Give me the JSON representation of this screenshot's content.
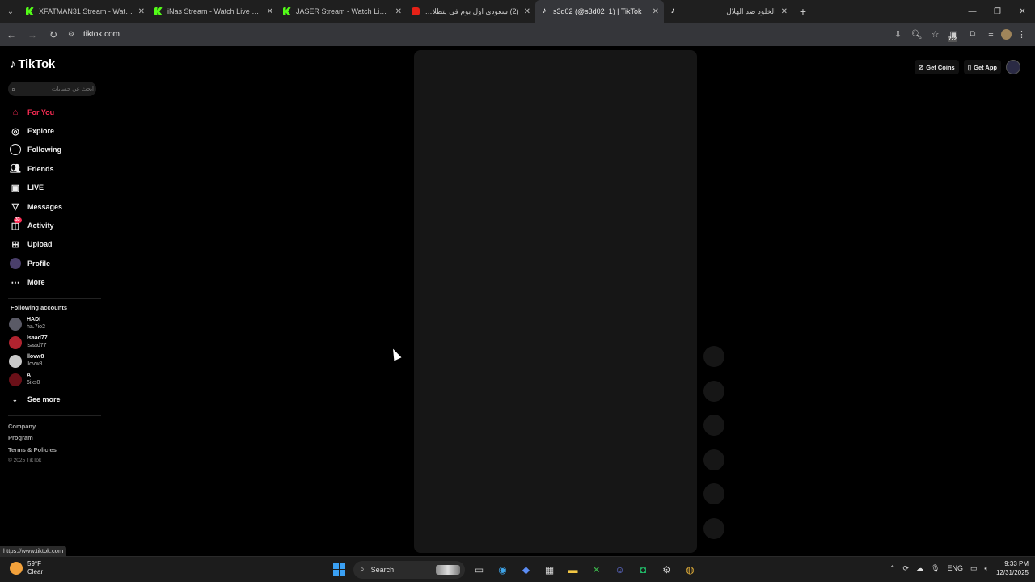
{
  "browser": {
    "tabs": [
      {
        "title": "XFATMAN31 Stream - Watch Live on Kick",
        "favicon": "kick-icon",
        "active": false
      },
      {
        "title": "iNas Stream - Watch Live on Kick",
        "favicon": "kick-icon",
        "active": false
      },
      {
        "title": "JASER Stream - Watch Live on Kick",
        "favicon": "kick-icon",
        "active": false
      },
      {
        "title": "(2) سعودي اول يوم في يتطلاديش",
        "favicon": "youtube-icon",
        "active": false
      },
      {
        "title": "s3d02 (@s3d02_1) | TikTok",
        "favicon": "tiktok-icon",
        "active": true
      },
      {
        "title": "الخلود ضد الهلال",
        "favicon": "tiktok-icon",
        "active": false
      }
    ],
    "url": "tiktok.com",
    "extension_badge": "722",
    "status_url": "https://www.tiktok.com"
  },
  "tiktok": {
    "logo": "TikTok",
    "search_placeholder": "ابحث عن حسابات",
    "nav": [
      {
        "label": "For You",
        "icon": "home-icon",
        "active": true
      },
      {
        "label": "Explore",
        "icon": "compass-icon"
      },
      {
        "label": "Following",
        "icon": "following-icon"
      },
      {
        "label": "Friends",
        "icon": "friends-icon"
      },
      {
        "label": "LIVE",
        "icon": "live-icon"
      },
      {
        "label": "Messages",
        "icon": "messages-icon"
      },
      {
        "label": "Activity",
        "icon": "activity-icon",
        "badge": "33"
      },
      {
        "label": "Upload",
        "icon": "upload-icon"
      },
      {
        "label": "Profile",
        "icon": "profile-icon"
      },
      {
        "label": "More",
        "icon": "more-icon"
      }
    ],
    "following_header": "Following accounts",
    "accounts": [
      {
        "name": "HADI",
        "username": "ha.7io2",
        "color": "#5a5a66"
      },
      {
        "name": "lsaad77",
        "username": "lsaad77_",
        "color": "#b0232f"
      },
      {
        "name": "llovw8",
        "username": "llovw8",
        "color": "#c9c9c9"
      },
      {
        "name": "A",
        "username": "6ixs0",
        "color": "#6b1018"
      }
    ],
    "see_more": "See more",
    "footer": [
      "Company",
      "Program",
      "Terms & Policies"
    ],
    "copyright": "© 2025 TikTok",
    "get_coins": "Get Coins",
    "get_app": "Get App"
  },
  "taskbar": {
    "weather_temp": "59°F",
    "weather_desc": "Clear",
    "search_label": "Search",
    "language": "ENG",
    "time": "9:33 PM",
    "date": "12/31/2025"
  },
  "colors": {
    "accent": "#fe2c55",
    "background": "#000000",
    "video_placeholder": "#161616"
  }
}
